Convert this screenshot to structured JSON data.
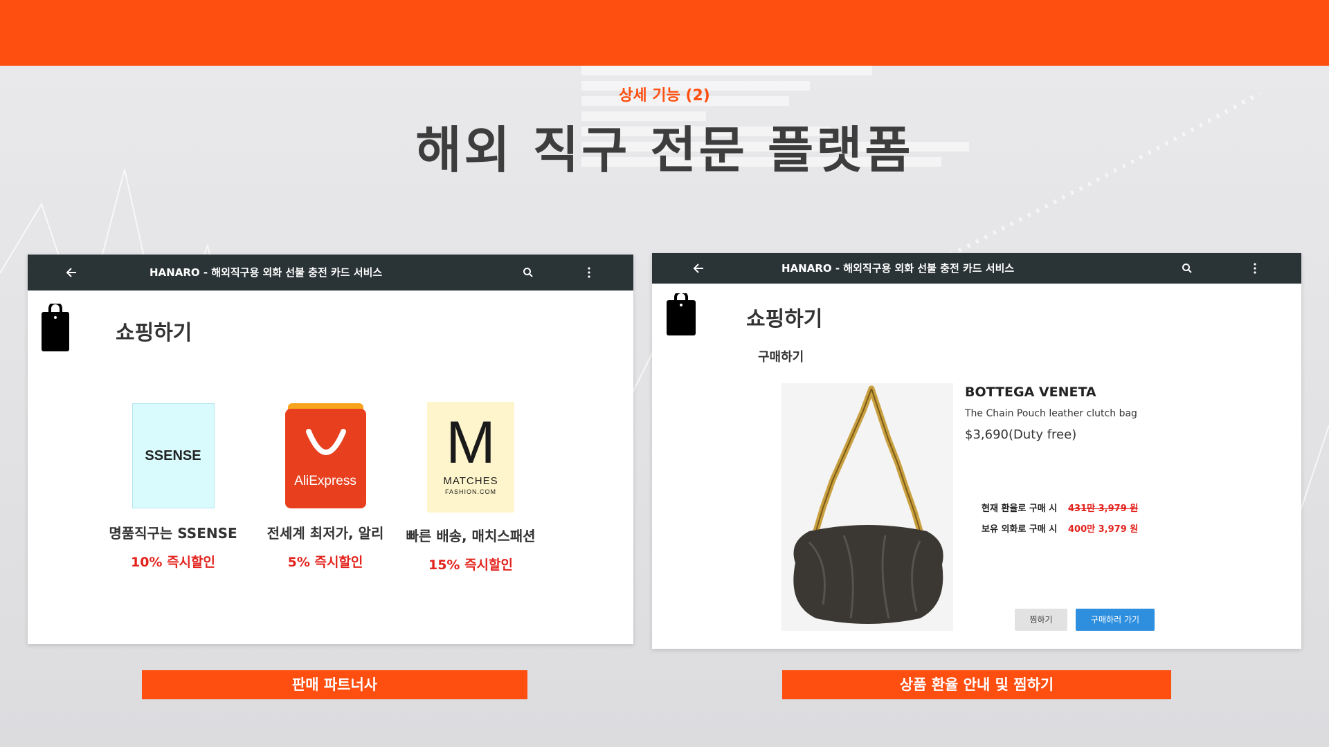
{
  "header": {
    "subtitle": "상세 기능 (2)",
    "title": "해외 직구 전문 플랫폼"
  },
  "left_screen": {
    "app_title": "HANARO - 해외직구용 외화 선불 충전 카드 서비스",
    "icons": [
      "arrow-left-icon",
      "search-icon",
      "more-vertical-icon",
      "shopping-bag-icon"
    ],
    "heading": "쇼핑하기",
    "partners": [
      {
        "logo_text": "SSENSE",
        "name": "명품직구는 SSENSE",
        "discount": "10% 즉시할인",
        "logo_color": "#d9fbfd"
      },
      {
        "logo_text": "AliExpress",
        "name": "전세계 최저가, 알리",
        "discount": "5% 즉시할인",
        "logo_color": "#e8401f"
      },
      {
        "logo_text_main": "M",
        "logo_text_sub1": "MATCHES",
        "logo_text_sub2": "FASHION.COM",
        "name": "빠른 배송, 매치스패션",
        "discount": "15% 즉시할인",
        "logo_color": "#fff5cc"
      }
    ]
  },
  "right_screen": {
    "app_title": "HANARO - 해외직구용 외화 선불 충전 카드 서비스",
    "icons": [
      "arrow-left-icon",
      "search-icon",
      "more-vertical-icon",
      "shopping-bag-icon"
    ],
    "heading": "쇼핑하기",
    "subheading": "구매하기",
    "product": {
      "brand": "BOTTEGA VENETA",
      "name": "The Chain Pouch leather clutch bag",
      "price": "$3,690(Duty free)"
    },
    "rates": [
      {
        "label": "현재 환율로 구매 시",
        "value": "431만 3,979 원",
        "strikethrough": true
      },
      {
        "label": "보유 외화로 구매 시",
        "value": "400만 3,979 원",
        "strikethrough": false
      }
    ],
    "wishlist_label": "찜하기",
    "buy_label": "구매하러 가기"
  },
  "captions": {
    "left": "판매 파트너사",
    "right": "상품  환율 안내 및 찜하기"
  },
  "colors": {
    "accent": "#fe4e10",
    "appbar": "#2a3336",
    "discount": "#e3231d",
    "buy_button": "#2f8fdf"
  }
}
